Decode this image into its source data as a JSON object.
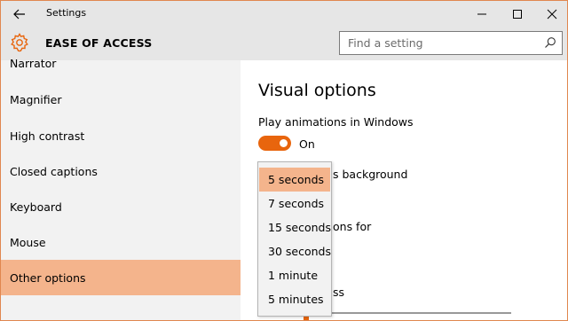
{
  "window": {
    "title": "Settings"
  },
  "header": {
    "title": "EASE OF ACCESS"
  },
  "search": {
    "placeholder": "Find a setting",
    "value": ""
  },
  "sidebar": {
    "items": [
      {
        "label": "Narrator"
      },
      {
        "label": "Magnifier"
      },
      {
        "label": "High contrast"
      },
      {
        "label": "Closed captions"
      },
      {
        "label": "Keyboard"
      },
      {
        "label": "Mouse"
      },
      {
        "label": "Other options",
        "selected": true
      }
    ]
  },
  "content": {
    "title": "Visual options",
    "animations_label": "Play animations in Windows",
    "animations_state": "On",
    "background_label_partial": "s background",
    "notifications_label_partial": "ons for",
    "cursor_label_partial": "ss"
  },
  "dropdown": {
    "options": [
      "5 seconds",
      "7 seconds",
      "15 seconds",
      "30 seconds",
      "1 minute",
      "5 minutes"
    ],
    "selected": "5 seconds"
  },
  "colors": {
    "accent": "#e8650d",
    "selection": "#f4b48c",
    "window_border": "#e0874f",
    "chrome": "#e6e6e6",
    "sidebar_bg": "#f2f2f2"
  },
  "icons": {
    "back": "back-arrow-icon",
    "minimize": "minimize-icon",
    "maximize": "maximize-icon",
    "close": "close-icon",
    "header": "gear-icon",
    "search": "search-icon"
  }
}
